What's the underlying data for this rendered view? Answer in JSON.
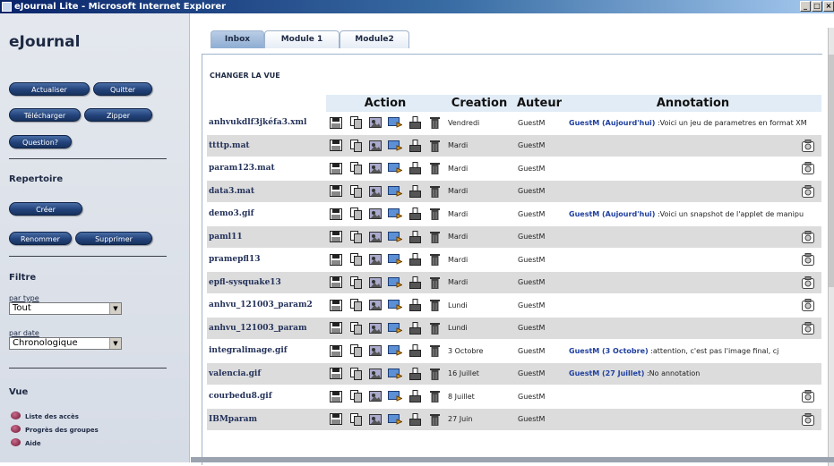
{
  "window": {
    "title": "eJournal Lite - Microsoft Internet Explorer",
    "buttons": [
      "_",
      "□",
      "×"
    ]
  },
  "sidebar": {
    "brand": "eJournal",
    "actions": {
      "refresh": "Actualiser",
      "quit": "Quitter",
      "download": "Télécharger",
      "zip": "Zipper",
      "question": "Question?"
    },
    "directory": {
      "heading": "Repertoire",
      "create": "Créer",
      "rename": "Renommer",
      "delete": "Supprimer"
    },
    "filter": {
      "heading": "Filtre",
      "by_type_label": "par type",
      "by_type_value": "Tout",
      "by_date_label": "par date",
      "by_date_value": "Chronologique"
    },
    "view": {
      "heading": "Vue",
      "items": [
        "Liste des accès",
        "Progrès des groupes",
        "Aide"
      ]
    }
  },
  "tabs": [
    {
      "label": "Inbox",
      "active": true
    },
    {
      "label": "Module 1",
      "active": false
    },
    {
      "label": "Module2",
      "active": false
    }
  ],
  "change_view": "CHANGER LA VUE",
  "table": {
    "headers": {
      "action": "Action",
      "creation": "Creation",
      "author": "Auteur",
      "annotation": "Annotation"
    },
    "action_icons": [
      "save-icon",
      "copy-icon",
      "view-icon",
      "send-icon",
      "print-icon",
      "trash-icon"
    ],
    "rows": [
      {
        "name": "anhvukdlf3jkéfa3.xml",
        "date": "Vendredi",
        "author": "GuestM",
        "annot_who": "GuestM (Aujourd'hui)",
        "annot_text": " :Voici un jeu de parametres en format XM"
      },
      {
        "name": "ttttp.mat",
        "date": "Mardi",
        "author": "GuestM",
        "annot_who": "",
        "annot_text": ""
      },
      {
        "name": "param123.mat",
        "date": "Mardi",
        "author": "GuestM",
        "annot_who": "",
        "annot_text": ""
      },
      {
        "name": "data3.mat",
        "date": "Mardi",
        "author": "GuestM",
        "annot_who": "",
        "annot_text": ""
      },
      {
        "name": "demo3.gif",
        "date": "Mardi",
        "author": "GuestM",
        "annot_who": "GuestM (Aujourd'hui)",
        "annot_text": " :Voici un snapshot de l'applet de manipu"
      },
      {
        "name": "paml11",
        "date": "Mardi",
        "author": "GuestM",
        "annot_who": "",
        "annot_text": ""
      },
      {
        "name": "pramepfl13",
        "date": "Mardi",
        "author": "GuestM",
        "annot_who": "",
        "annot_text": ""
      },
      {
        "name": "epfl-sysquake13",
        "date": "Mardi",
        "author": "GuestM",
        "annot_who": "",
        "annot_text": ""
      },
      {
        "name": "anhvu_121003_param2",
        "date": "Lundi",
        "author": "GuestM",
        "annot_who": "",
        "annot_text": ""
      },
      {
        "name": "anhvu_121003_param",
        "date": "Lundi",
        "author": "GuestM",
        "annot_who": "",
        "annot_text": ""
      },
      {
        "name": "integralimage.gif",
        "date": "3 Octobre",
        "author": "GuestM",
        "annot_who": "GuestM (3 Octobre)",
        "annot_text": " :attention, c'est pas l'image final, cj"
      },
      {
        "name": "valencia.gif",
        "date": "16 Juillet",
        "author": "GuestM",
        "annot_who": "GuestM (27 Juillet)",
        "annot_text": " :No annotation"
      },
      {
        "name": "courbedu8.gif",
        "date": "8 Juillet",
        "author": "GuestM",
        "annot_who": "",
        "annot_text": ""
      },
      {
        "name": "IBMparam",
        "date": "27 Juin",
        "author": "GuestM",
        "annot_who": "",
        "annot_text": ""
      }
    ]
  }
}
